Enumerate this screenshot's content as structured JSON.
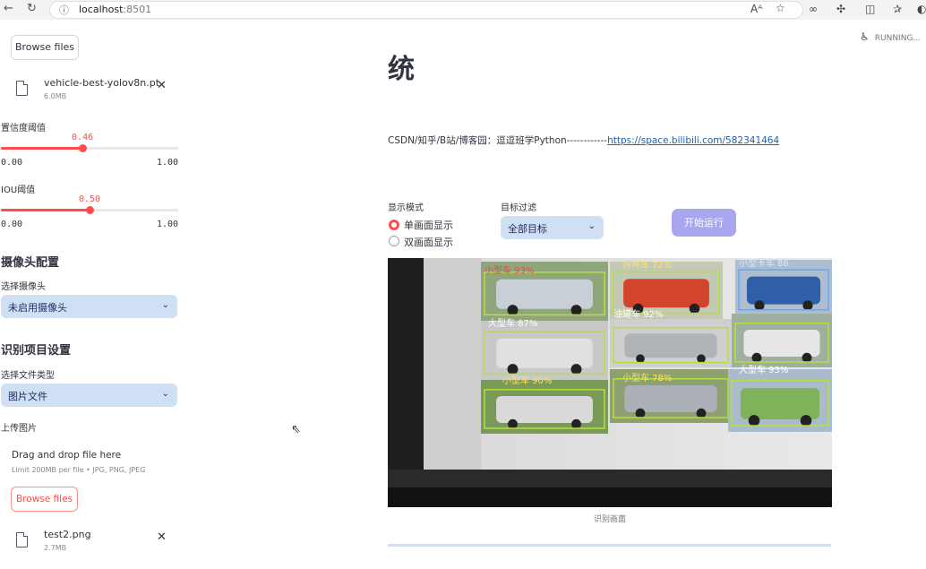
{
  "browser": {
    "back_icon": "back-arrow-icon",
    "reload_icon": "reload-icon",
    "url_host": "localhost",
    "url_port": ":8501"
  },
  "sidebar": {
    "browse_top_label": "Browse files",
    "model_file": {
      "name": "vehicle-best-yolov8n.pt",
      "size": "6.0MB"
    },
    "confidence": {
      "label": "置信度阈值",
      "value": "0.46",
      "fraction": 0.46,
      "min": "0.00",
      "max": "1.00"
    },
    "iou": {
      "label": "IOU阈值",
      "value": "0.50",
      "fraction": 0.5,
      "min": "0.00",
      "max": "1.00"
    },
    "camera_section_title": "摄像头配置",
    "camera_select_label": "选择摄像头",
    "camera_select_value": "未启用摄像头",
    "recognition_section_title": "识别项目设置",
    "file_type_label": "选择文件类型",
    "file_type_value": "图片文件",
    "upload_label": "上传图片",
    "dropzone_title": "Drag and drop file here",
    "dropzone_subtitle": "Limit 200MB per file • JPG, PNG, JPEG",
    "browse_label": "Browse files",
    "uploaded_file": {
      "name": "test2.png",
      "size": "2.7MB"
    }
  },
  "main": {
    "status": "RUNNING...",
    "title": "统",
    "info_prefix": "CSDN/知乎/B站/博客园：逗逗班学Python------------",
    "info_link": "https://space.bilibili.com/582341464",
    "display_mode_label": "显示模式",
    "display_modes": [
      "单画面显示",
      "双画面显示"
    ],
    "selected_mode": 0,
    "target_filter_label": "目标过滤",
    "target_filter_value": "全部目标",
    "run_button": "开始运行",
    "image_caption": "识别画面",
    "detections": [
      {
        "label": "小型车 93%"
      },
      {
        "label": "特种车 72%"
      },
      {
        "label": "小型卡车 86"
      },
      {
        "label": "大型车 87%"
      },
      {
        "label": "油罐车 92%"
      },
      {
        "label": "大型车 93%"
      },
      {
        "label": "小型车 90%"
      },
      {
        "label": "小型车 78%"
      }
    ]
  }
}
